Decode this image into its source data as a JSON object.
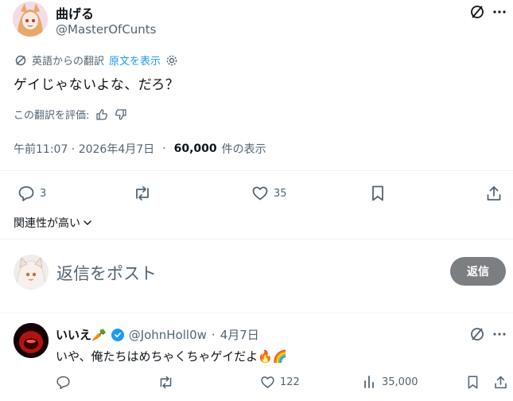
{
  "author": {
    "name": "曲げる",
    "handle": "@MasterOfCunts"
  },
  "translation": {
    "label": "英語からの翻訳",
    "show_original": "原文を表示"
  },
  "tweet": {
    "text": "ゲイじゃないよな、だろ？",
    "rate_label": "この翻訳を評価:",
    "timestamp": "午前11:07 · 2026年4月7日",
    "dot": "·",
    "views_count": "60,000",
    "views_label": "件の表示"
  },
  "actions": {
    "replies": "3",
    "likes": "35"
  },
  "sort": {
    "label": "関連性が高い"
  },
  "composer": {
    "placeholder": "返信をポスト",
    "button": "返信"
  },
  "reply": {
    "name": "いいえ🥕",
    "handle": "@JohnHoll0w",
    "dot": "·",
    "date": "4月7日",
    "text": "いや、俺たちはめちゃくちゃゲイだよ🔥🌈",
    "likes": "122",
    "views": "35,000"
  },
  "colors": {
    "accent": "#1d9bf0",
    "muted": "#536471",
    "reply_button": "#7c7f82"
  }
}
